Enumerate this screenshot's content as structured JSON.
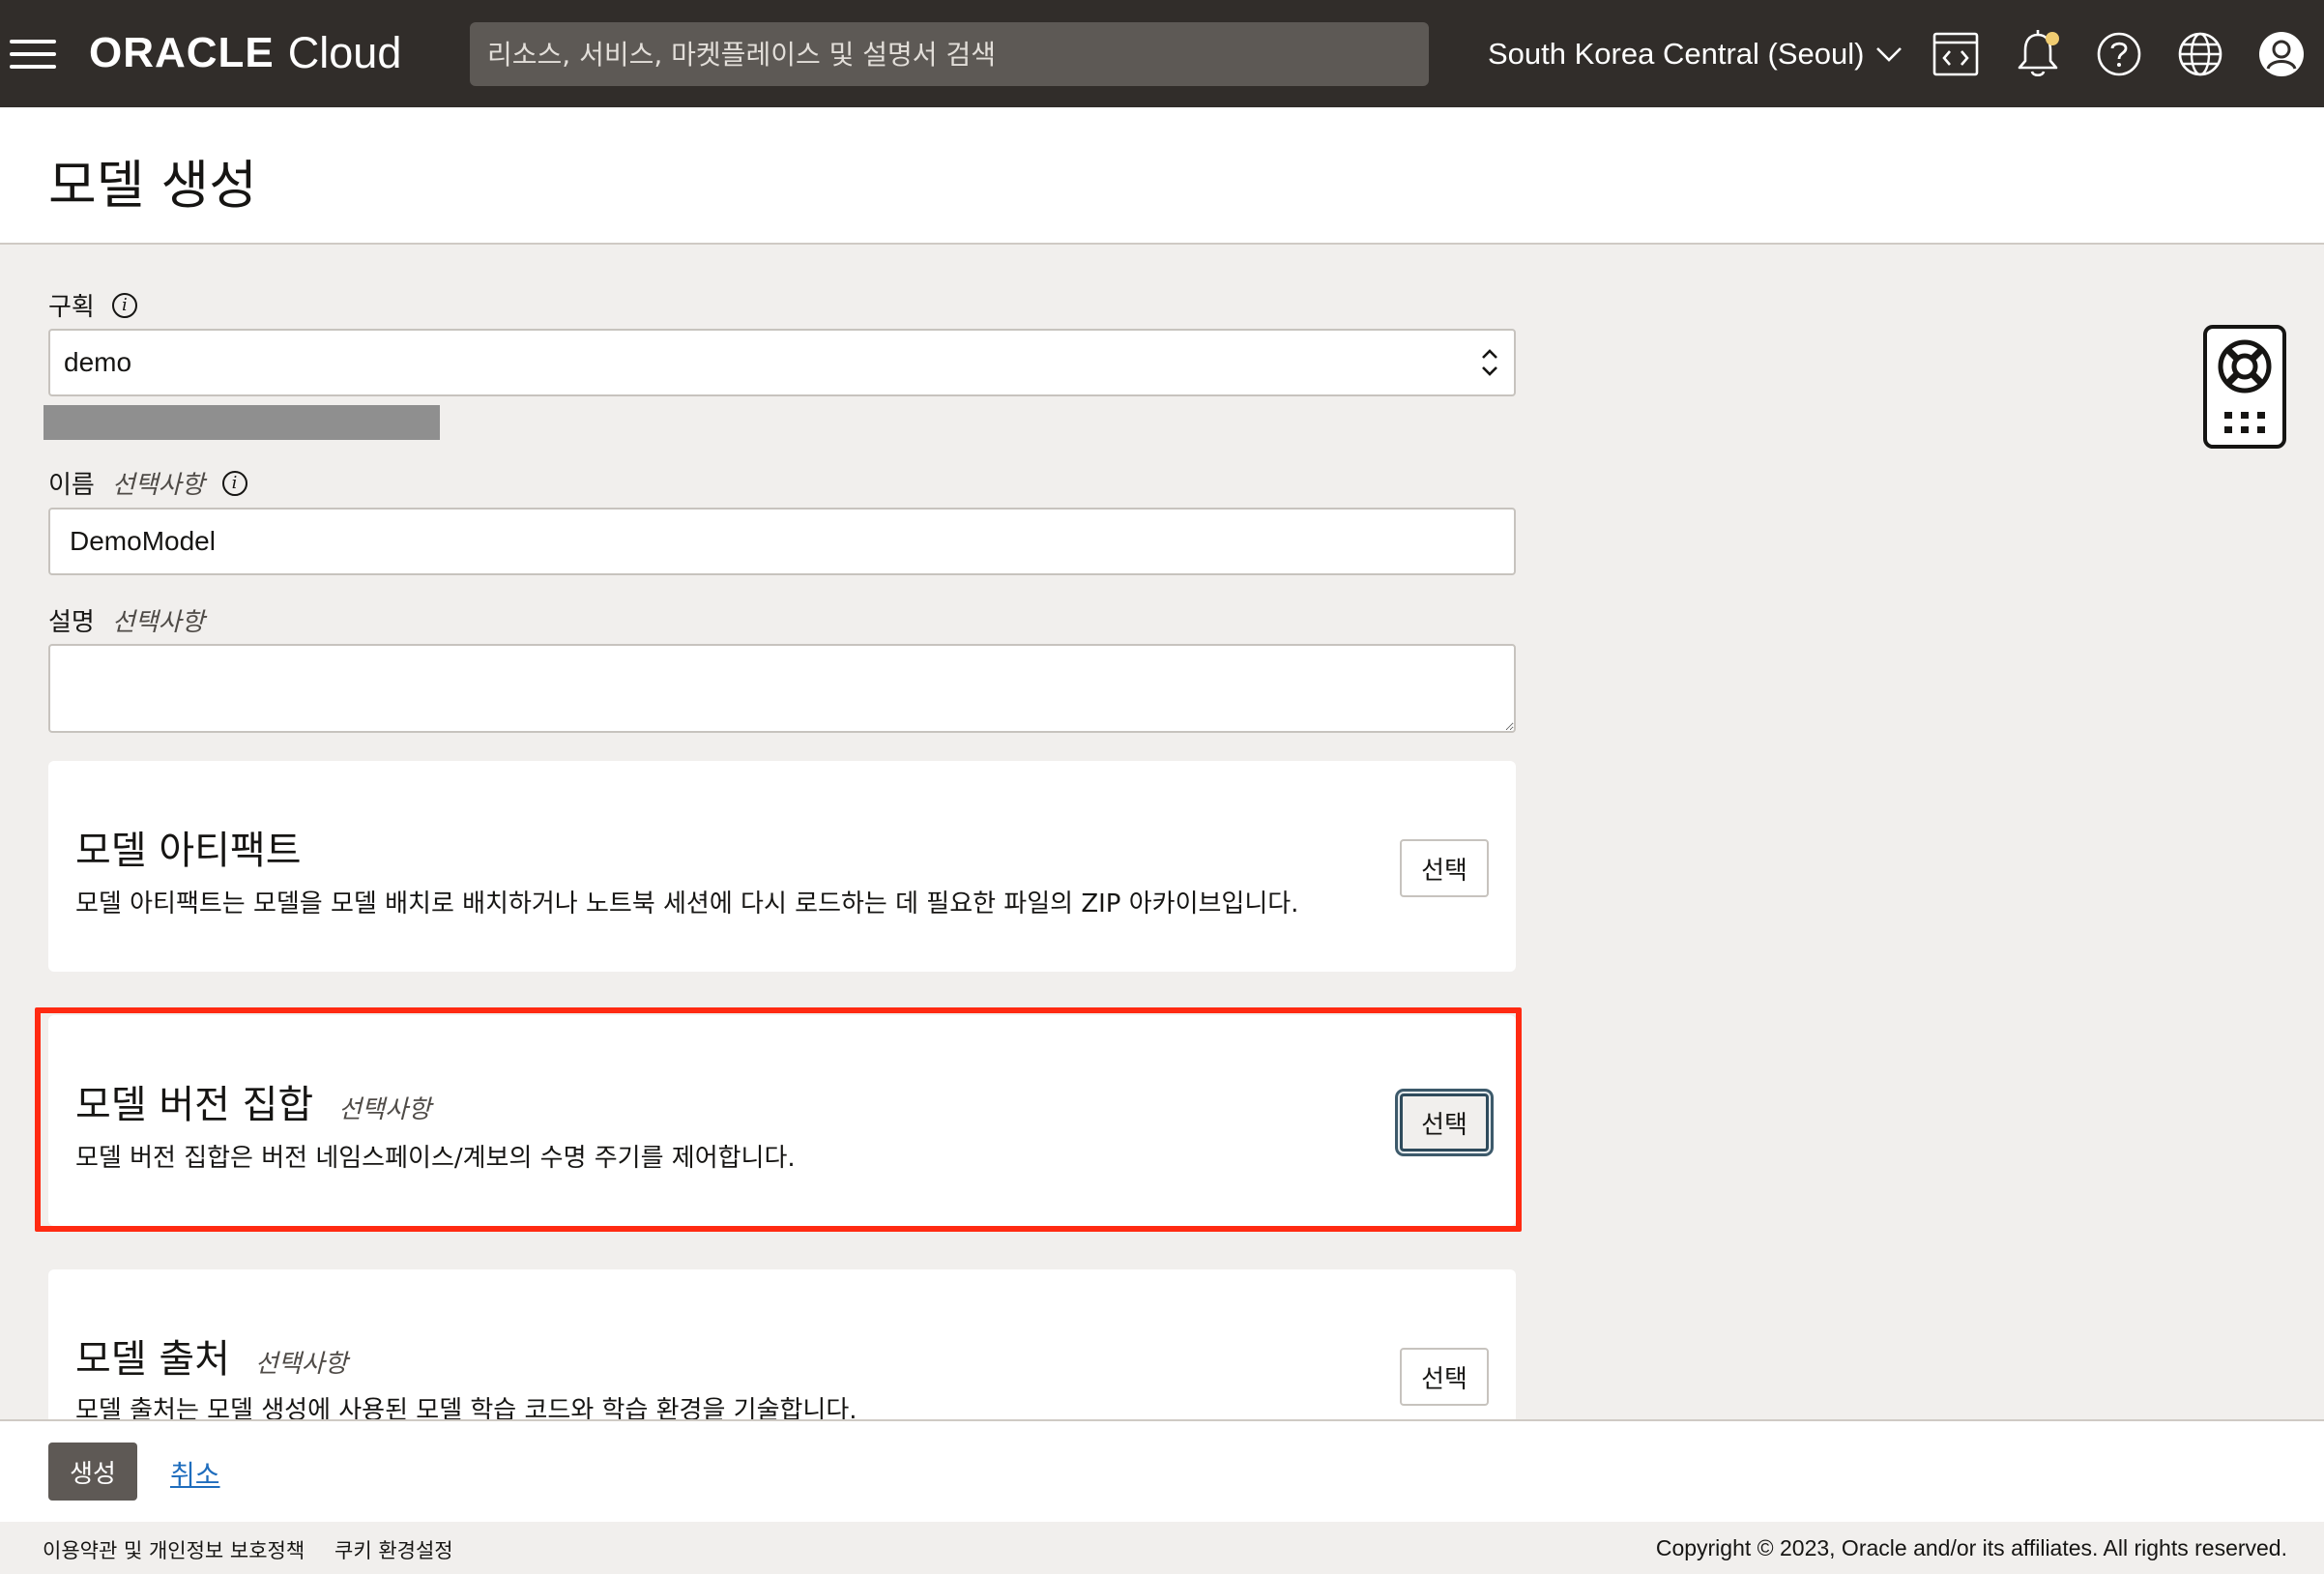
{
  "topbar": {
    "brand_oracle": "ORACLE",
    "brand_cloud": "Cloud",
    "search_placeholder": "리소스, 서비스, 마켓플레이스 및 설명서 검색",
    "region": "South Korea Central (Seoul)"
  },
  "page": {
    "title": "모델 생성"
  },
  "form": {
    "compartment": {
      "label": "구획",
      "value": "demo"
    },
    "name": {
      "label": "이름",
      "optional": "선택사항",
      "value": "DemoModel"
    },
    "description": {
      "label": "설명",
      "optional": "선택사항",
      "value": ""
    }
  },
  "cards": {
    "artifact": {
      "title": "모델 아티팩트",
      "description": "모델 아티팩트는 모델을 모델 배치로 배치하거나 노트북 세션에 다시 로드하는 데 필요한 파일의 ZIP 아카이브입니다.",
      "button": "선택"
    },
    "version_set": {
      "title": "모델 버전 집합",
      "optional": "선택사항",
      "description": "모델 버전 집합은 버전 네임스페이스/계보의 수명 주기를 제어합니다.",
      "button": "선택"
    },
    "provenance": {
      "title": "모델 출처",
      "optional": "선택사항",
      "description": "모델 출처는 모델 생성에 사용된 모델 학습 코드와 학습 환경을 기술합니다.",
      "button": "선택"
    }
  },
  "actions": {
    "create": "생성",
    "cancel": "취소"
  },
  "footer": {
    "terms": "이용약관 및 개인정보 보호정책",
    "cookies": "쿠키 환경설정",
    "copyright": "Copyright © 2023, Oracle and/or its affiliates. All rights reserved."
  },
  "colors": {
    "topbar": "#312d2a",
    "highlight": "#ff2a12",
    "link": "#1f6dbd",
    "notification_dot": "#f0cc71"
  }
}
